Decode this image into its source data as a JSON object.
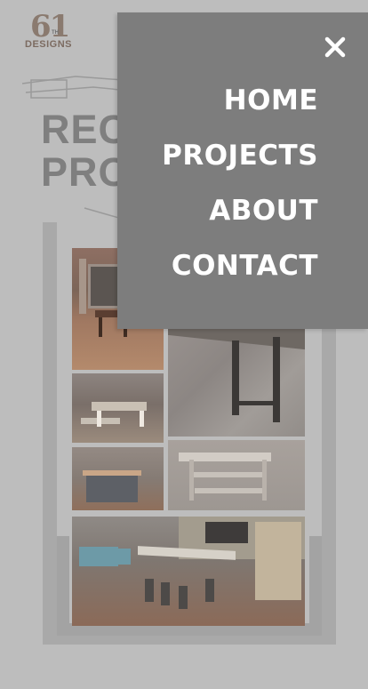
{
  "logo": {
    "number": "61",
    "superscript": "TH",
    "word": "DESIGNS"
  },
  "page": {
    "heading_line1": "RECENT",
    "heading_line2": "PROJECTS"
  },
  "menu": {
    "close_icon": "close-icon",
    "items": [
      {
        "label": "HOME"
      },
      {
        "label": "PROJECTS"
      },
      {
        "label": "ABOUT"
      },
      {
        "label": "CONTACT"
      }
    ]
  },
  "colors": {
    "menu_background": "#7d7d7d",
    "menu_text": "#ffffff",
    "page_background": "#bdbdbd"
  }
}
